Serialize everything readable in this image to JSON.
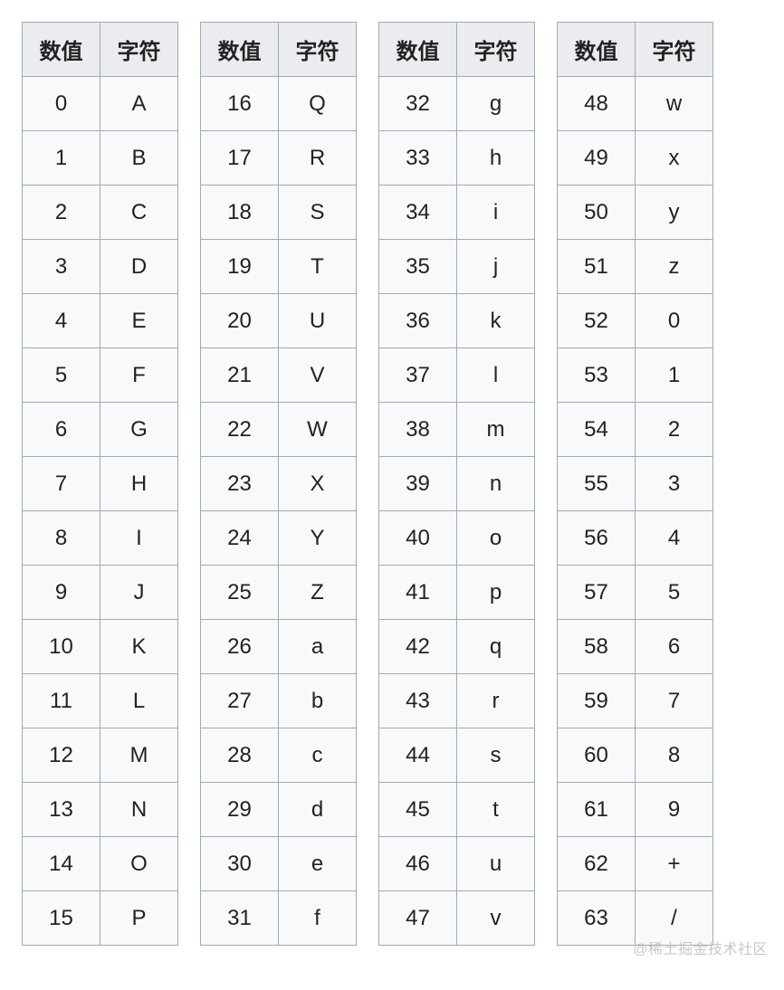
{
  "headers": {
    "value": "数值",
    "char": "字符"
  },
  "columns": [
    [
      {
        "v": "0",
        "c": "A"
      },
      {
        "v": "1",
        "c": "B"
      },
      {
        "v": "2",
        "c": "C"
      },
      {
        "v": "3",
        "c": "D"
      },
      {
        "v": "4",
        "c": "E"
      },
      {
        "v": "5",
        "c": "F"
      },
      {
        "v": "6",
        "c": "G"
      },
      {
        "v": "7",
        "c": "H"
      },
      {
        "v": "8",
        "c": "I"
      },
      {
        "v": "9",
        "c": "J"
      },
      {
        "v": "10",
        "c": "K"
      },
      {
        "v": "11",
        "c": "L"
      },
      {
        "v": "12",
        "c": "M"
      },
      {
        "v": "13",
        "c": "N"
      },
      {
        "v": "14",
        "c": "O"
      },
      {
        "v": "15",
        "c": "P"
      }
    ],
    [
      {
        "v": "16",
        "c": "Q"
      },
      {
        "v": "17",
        "c": "R"
      },
      {
        "v": "18",
        "c": "S"
      },
      {
        "v": "19",
        "c": "T"
      },
      {
        "v": "20",
        "c": "U"
      },
      {
        "v": "21",
        "c": "V"
      },
      {
        "v": "22",
        "c": "W"
      },
      {
        "v": "23",
        "c": "X"
      },
      {
        "v": "24",
        "c": "Y"
      },
      {
        "v": "25",
        "c": "Z"
      },
      {
        "v": "26",
        "c": "a"
      },
      {
        "v": "27",
        "c": "b"
      },
      {
        "v": "28",
        "c": "c"
      },
      {
        "v": "29",
        "c": "d"
      },
      {
        "v": "30",
        "c": "e"
      },
      {
        "v": "31",
        "c": "f"
      }
    ],
    [
      {
        "v": "32",
        "c": "g"
      },
      {
        "v": "33",
        "c": "h"
      },
      {
        "v": "34",
        "c": "i"
      },
      {
        "v": "35",
        "c": "j"
      },
      {
        "v": "36",
        "c": "k"
      },
      {
        "v": "37",
        "c": "l"
      },
      {
        "v": "38",
        "c": "m"
      },
      {
        "v": "39",
        "c": "n"
      },
      {
        "v": "40",
        "c": "o"
      },
      {
        "v": "41",
        "c": "p"
      },
      {
        "v": "42",
        "c": "q"
      },
      {
        "v": "43",
        "c": "r"
      },
      {
        "v": "44",
        "c": "s"
      },
      {
        "v": "45",
        "c": "t"
      },
      {
        "v": "46",
        "c": "u"
      },
      {
        "v": "47",
        "c": "v"
      }
    ],
    [
      {
        "v": "48",
        "c": "w"
      },
      {
        "v": "49",
        "c": "x"
      },
      {
        "v": "50",
        "c": "y"
      },
      {
        "v": "51",
        "c": "z"
      },
      {
        "v": "52",
        "c": "0"
      },
      {
        "v": "53",
        "c": "1"
      },
      {
        "v": "54",
        "c": "2"
      },
      {
        "v": "55",
        "c": "3"
      },
      {
        "v": "56",
        "c": "4"
      },
      {
        "v": "57",
        "c": "5"
      },
      {
        "v": "58",
        "c": "6"
      },
      {
        "v": "59",
        "c": "7"
      },
      {
        "v": "60",
        "c": "8"
      },
      {
        "v": "61",
        "c": "9"
      },
      {
        "v": "62",
        "c": "+"
      },
      {
        "v": "63",
        "c": "/"
      }
    ]
  ],
  "watermark": "@稀土掘金技术社区"
}
